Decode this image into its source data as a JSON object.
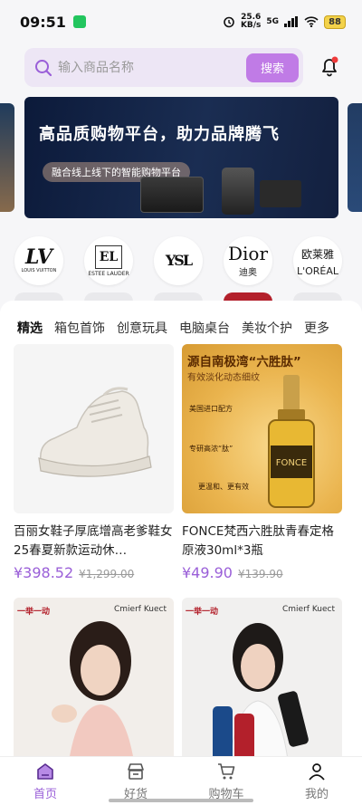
{
  "status": {
    "time": "09:51",
    "speed_value": "25.6",
    "speed_unit": "KB/s",
    "network": "5G",
    "battery": "88"
  },
  "search": {
    "placeholder": "输入商品名称",
    "button": "搜索"
  },
  "banner": {
    "title": "高品质购物平台，助力品牌腾飞",
    "subtitle": "融合线上线下的智能购物平台"
  },
  "brands": [
    {
      "logo": "LV",
      "small": "LOUIS VUITTON"
    },
    {
      "logo": "EL",
      "small": "ESTEE LAUDER"
    },
    {
      "logo": "YSL",
      "small": ""
    },
    {
      "logo": "Dior",
      "small": "迪奥"
    },
    {
      "logo": "欧莱雅",
      "small": "L'ORÉAL"
    }
  ],
  "tabs": [
    "精选",
    "箱包首饰",
    "创意玩具",
    "电脑桌台",
    "美妆个护",
    "更多"
  ],
  "products": [
    {
      "name": "百丽女鞋子厚底增高老爹鞋女25春夏新款运动休…",
      "price": "¥398.52",
      "old_price": "¥1,299.00"
    },
    {
      "name": "FONCE梵西六胜肽青春定格原液30ml*3瓶",
      "price": "¥49.90",
      "old_price": "¥139.90",
      "ad_title": "源自南极湾“六胜肽”",
      "ad_sub": "有效淡化动态细纹",
      "ad_points": [
        "美国进口配方",
        "专研高浓“肽”",
        "更温和、更有效"
      ]
    },
    {
      "brand_text": "Cmierf Kuect",
      "badge": "一举一动"
    },
    {
      "brand_text": "Cmierf Kuect",
      "badge": "一举一动"
    }
  ],
  "nav": [
    {
      "label": "首页",
      "icon": "home-icon"
    },
    {
      "label": "好货",
      "icon": "goods-icon"
    },
    {
      "label": "购物车",
      "icon": "cart-icon"
    },
    {
      "label": "我的",
      "icon": "profile-icon"
    }
  ],
  "colors": {
    "accent": "#9a5fd8",
    "search_bg": "#ede6f5",
    "search_button": "#c07be6"
  }
}
